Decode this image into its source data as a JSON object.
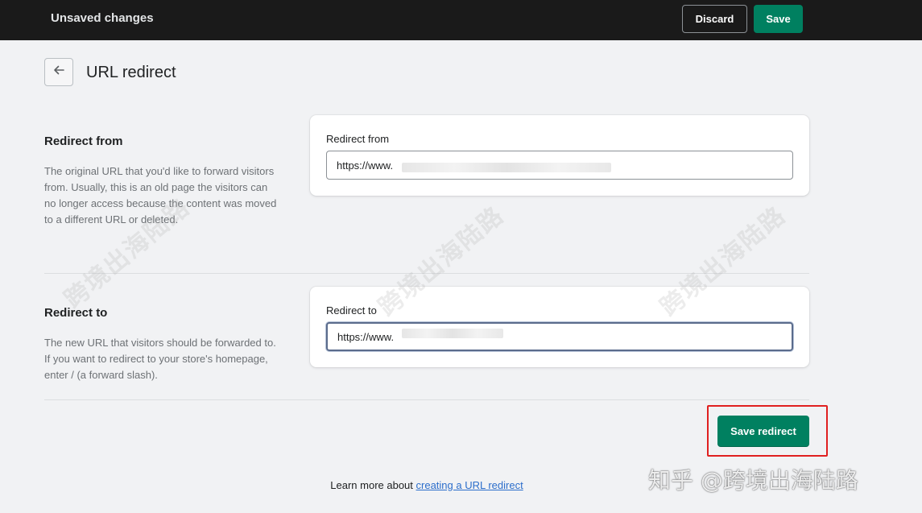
{
  "topbar": {
    "title": "Unsaved changes",
    "discard_label": "Discard",
    "save_label": "Save"
  },
  "page": {
    "title": "URL redirect",
    "back_icon": "arrow-left-icon"
  },
  "redirect_from": {
    "section_title": "Redirect from",
    "description": "The original URL that you'd like to forward visitors from. Usually, this is an old page the visitors can no longer access because the content was moved to a different URL or deleted.",
    "field_label": "Redirect from",
    "value": "https://www."
  },
  "redirect_to": {
    "section_title": "Redirect to",
    "description": "The new URL that visitors should be forwarded to. If you want to redirect to your store's homepage, enter / (a forward slash).",
    "field_label": "Redirect to",
    "value": "https://www."
  },
  "actions": {
    "save_redirect_label": "Save redirect"
  },
  "footer": {
    "prefix": "Learn more about ",
    "link_label": "creating a URL redirect"
  },
  "watermark": {
    "text": "跨境出海陆路",
    "brand": "知乎 @跨境出海陆路"
  },
  "colors": {
    "topbar_bg": "#1a1a1a",
    "primary": "#008060",
    "highlight": "#e02020",
    "link": "#2c6ecb"
  }
}
